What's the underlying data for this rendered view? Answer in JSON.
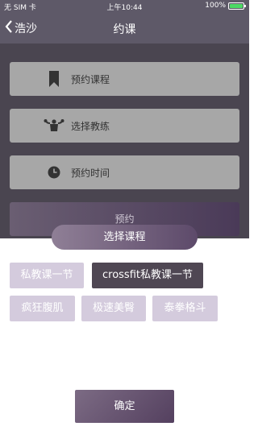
{
  "status_bar": {
    "carrier": "无 SIM 卡",
    "time": "上午10:44",
    "battery": "100%",
    "battery_level": 1.0
  },
  "navbar": {
    "back_label": "浩沙",
    "title": "约课"
  },
  "menu": [
    {
      "label": "预约课程",
      "icon": "bookmark-icon"
    },
    {
      "label": "选择教练",
      "icon": "muscle-icon"
    },
    {
      "label": "预约时间",
      "icon": "clock-icon"
    }
  ],
  "book_button": "预约",
  "sheet": {
    "title": "选择课程",
    "tags": [
      {
        "label": "私教课一节",
        "selected": false
      },
      {
        "label": "crossfit私教课一节",
        "selected": true
      },
      {
        "label": "疯狂腹肌",
        "selected": false
      },
      {
        "label": "极速美臀",
        "selected": false
      },
      {
        "label": "泰拳格斗",
        "selected": false
      }
    ],
    "confirm": "确定"
  },
  "colors": {
    "header": "#5e5968",
    "backdrop": "#4a4550",
    "tag": "#d4cbdd",
    "tag_selected": "#4f4753",
    "accent": "#5d4a6a"
  }
}
